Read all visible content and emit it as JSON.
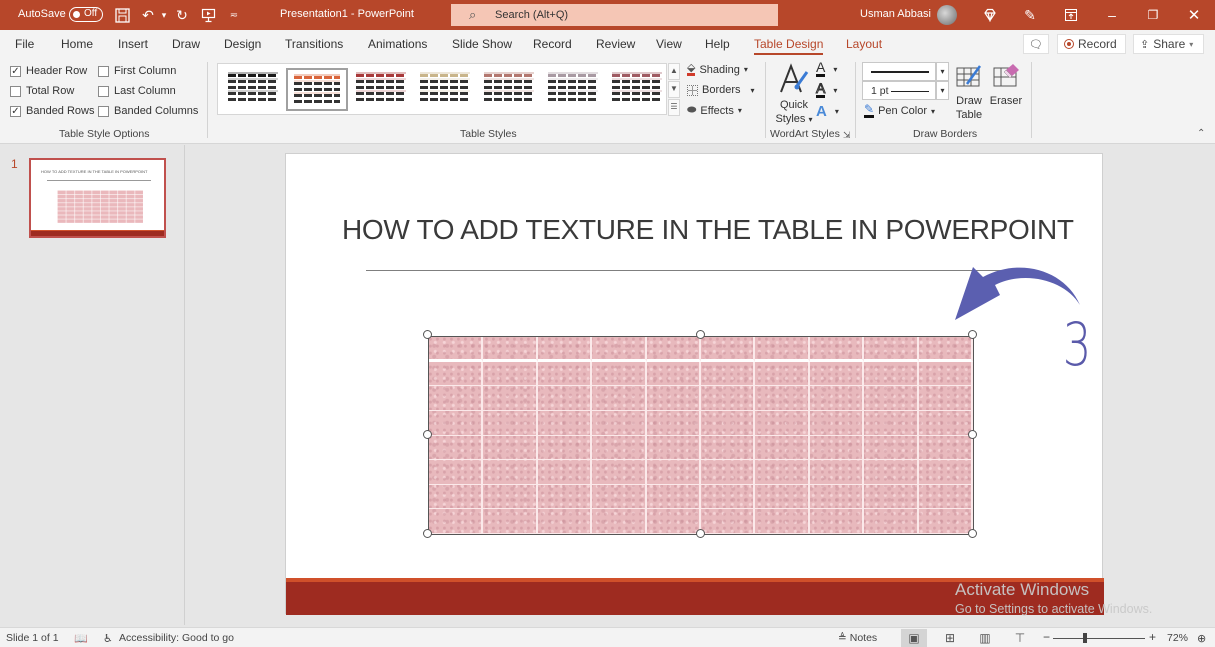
{
  "titlebar": {
    "autosave_label": "AutoSave",
    "autosave_state": "Off",
    "doc_title": "Presentation1  -  PowerPoint",
    "search_placeholder": "Search (Alt+Q)",
    "user_name": "Usman Abbasi",
    "colors": {
      "bar": "#b7472a",
      "search": "#f5c6b5"
    }
  },
  "tabs": [
    {
      "label": "File"
    },
    {
      "label": "Home"
    },
    {
      "label": "Insert"
    },
    {
      "label": "Draw"
    },
    {
      "label": "Design"
    },
    {
      "label": "Transitions"
    },
    {
      "label": "Animations"
    },
    {
      "label": "Slide Show"
    },
    {
      "label": "Record"
    },
    {
      "label": "Review"
    },
    {
      "label": "View"
    },
    {
      "label": "Help"
    },
    {
      "label": "Table Design",
      "active": true
    },
    {
      "label": "Layout",
      "contextual": true
    }
  ],
  "top_buttons": {
    "record": "Record",
    "share": "Share"
  },
  "ribbon": {
    "table_style_options": {
      "label": "Table Style Options",
      "options": [
        {
          "label": "Header Row",
          "checked": true
        },
        {
          "label": "First Column",
          "checked": false
        },
        {
          "label": "Total Row",
          "checked": false
        },
        {
          "label": "Last Column",
          "checked": false
        },
        {
          "label": "Banded Rows",
          "checked": true
        },
        {
          "label": "Banded Columns",
          "checked": false
        }
      ]
    },
    "table_styles": {
      "label": "Table Styles",
      "swatches": [
        "#1a1a1a",
        "#d9643a",
        "#a8393a",
        "#c9b58a",
        "#b3776f",
        "#a99aa3",
        "#9f5a62"
      ],
      "selected_index": 1
    },
    "shading_label": "Shading",
    "borders_label": "Borders",
    "effects_label": "Effects",
    "wordart": {
      "label": "WordArt Styles",
      "quick_styles": "Quick",
      "quick_styles_2": "Styles"
    },
    "draw_borders": {
      "label": "Draw Borders",
      "pen_weight": "1 pt",
      "pen_color": "Pen Color",
      "draw_table_1": "Draw",
      "draw_table_2": "Table",
      "eraser": "Eraser"
    }
  },
  "thumbnails": [
    {
      "number": "1",
      "title": "HOW TO ADD TEXTURE  IN THE TABLE IN POWERPOINT"
    }
  ],
  "slide": {
    "title": "HOW TO ADD TEXTURE  IN THE TABLE IN POWERPOINT",
    "annotation_number": "3",
    "table": {
      "rows": 8,
      "columns": 10,
      "fill": "pink marble texture"
    },
    "colors": {
      "footer": "#9e2b20",
      "footer_accent": "#d0502a",
      "arrow": "#5b5fb0"
    }
  },
  "watermark": {
    "line1": "Activate Windows",
    "line2": "Go to Settings to activate Windows."
  },
  "statusbar": {
    "slide_info": "Slide 1 of 1",
    "accessibility": "Accessibility: Good to go",
    "notes": "Notes",
    "zoom": "72%",
    "zoom_fraction": 0.72
  }
}
